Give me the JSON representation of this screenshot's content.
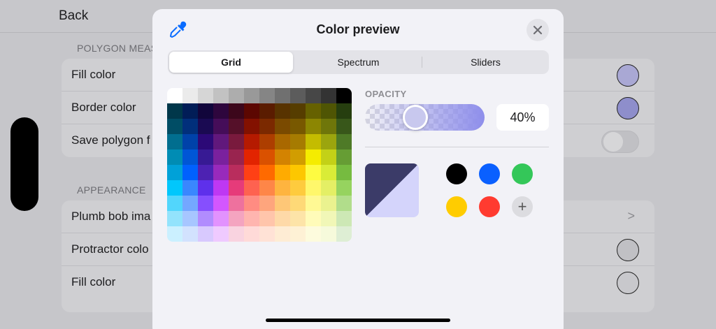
{
  "background": {
    "back_label": "Back",
    "sections": [
      {
        "header": "POLYGON MEAS",
        "rows": [
          {
            "label": "Fill color",
            "accessory": "swatch",
            "color": "#a9a8d4"
          },
          {
            "label": "Border color",
            "accessory": "swatch",
            "color": "#8e8ecb"
          },
          {
            "label": "Save polygon f",
            "accessory": "toggle"
          }
        ]
      },
      {
        "header": "APPEARANCE",
        "rows": [
          {
            "label": "Plumb bob ima",
            "accessory": "chevron",
            "chevron": ">"
          },
          {
            "label": "Protractor colo",
            "accessory": "swatch",
            "color": "#c0c0c4"
          },
          {
            "label": "Fill color",
            "accessory": "swatch",
            "color": "#c8c8cc"
          }
        ]
      }
    ]
  },
  "sheet": {
    "title": "Color preview",
    "tabs": [
      {
        "label": "Grid",
        "active": true
      },
      {
        "label": "Spectrum",
        "active": false
      },
      {
        "label": "Sliders",
        "active": false
      }
    ],
    "opacity_label": "OPACITY",
    "opacity_value": "40%",
    "opacity_fraction": 0.4,
    "preview_color": "#3b3b68",
    "preview_color_with_opacity": "#d4d4fb",
    "saved_colors": [
      {
        "name": "black",
        "hex": "#000000"
      },
      {
        "name": "blue",
        "hex": "#0a60ff"
      },
      {
        "name": "green",
        "hex": "#34c759"
      },
      {
        "name": "yellow",
        "hex": "#ffcc00"
      },
      {
        "name": "red",
        "hex": "#ff3b30"
      }
    ],
    "add_label": "+",
    "close_icon": "xmark-icon",
    "eyedropper_icon": "eyedropper-icon"
  },
  "grid_colors": [
    [
      "#ffffff",
      "#ebebeb",
      "#d6d6d6",
      "#c2c2c2",
      "#adadad",
      "#999999",
      "#858585",
      "#707070",
      "#5c5c5c",
      "#474747",
      "#333333",
      "#000000"
    ],
    [
      "#00374a",
      "#011d57",
      "#11053b",
      "#2e063d",
      "#3c071b",
      "#5c0701",
      "#5a1c00",
      "#583300",
      "#563d00",
      "#666100",
      "#4f5504",
      "#263e0f"
    ],
    [
      "#004d65",
      "#012f7b",
      "#1a0a52",
      "#450d59",
      "#551029",
      "#831100",
      "#7b2900",
      "#7a4a00",
      "#785800",
      "#8c8602",
      "#6f760a",
      "#38571a"
    ],
    [
      "#016e8f",
      "#0042a9",
      "#2c0977",
      "#61187c",
      "#791a3d",
      "#b51a00",
      "#ad3e00",
      "#a96800",
      "#a67b01",
      "#c4bc00",
      "#9ba50e",
      "#4e7a27"
    ],
    [
      "#008cb4",
      "#0056d6",
      "#371a94",
      "#7a219e",
      "#99244f",
      "#e22400",
      "#da5100",
      "#d38301",
      "#d19d01",
      "#f5ec00",
      "#c3d117",
      "#669d34"
    ],
    [
      "#00a1d8",
      "#0061fe",
      "#4d22b2",
      "#982abc",
      "#b92d5d",
      "#ff4015",
      "#ff6a00",
      "#ffab01",
      "#fdc700",
      "#fefb41",
      "#d9ec37",
      "#76bb40"
    ],
    [
      "#01c7fc",
      "#3a87fe",
      "#5e30eb",
      "#be38f3",
      "#e63b7a",
      "#fe6250",
      "#fe8648",
      "#feb43f",
      "#fecb3e",
      "#fff76b",
      "#e4ef65",
      "#96d35f"
    ],
    [
      "#52d6fc",
      "#74a7ff",
      "#864ffe",
      "#d357fe",
      "#ee719e",
      "#ff8c82",
      "#fea57d",
      "#fec777",
      "#fed977",
      "#fff994",
      "#eaf28f",
      "#b1dd8b"
    ],
    [
      "#93e3fc",
      "#a7c6ff",
      "#b18cfe",
      "#e292fe",
      "#f4a4c0",
      "#ffb5af",
      "#ffc5ab",
      "#fed9a8",
      "#fde4a8",
      "#fffbb9",
      "#f1f7b7",
      "#cde8b5"
    ],
    [
      "#cbf0ff",
      "#d2e2fe",
      "#d8c9fe",
      "#efcaff",
      "#f9d3e0",
      "#ffdad8",
      "#ffe2d6",
      "#feecd4",
      "#fef1d5",
      "#fdfbdd",
      "#f6fadb",
      "#deeed4"
    ]
  ]
}
